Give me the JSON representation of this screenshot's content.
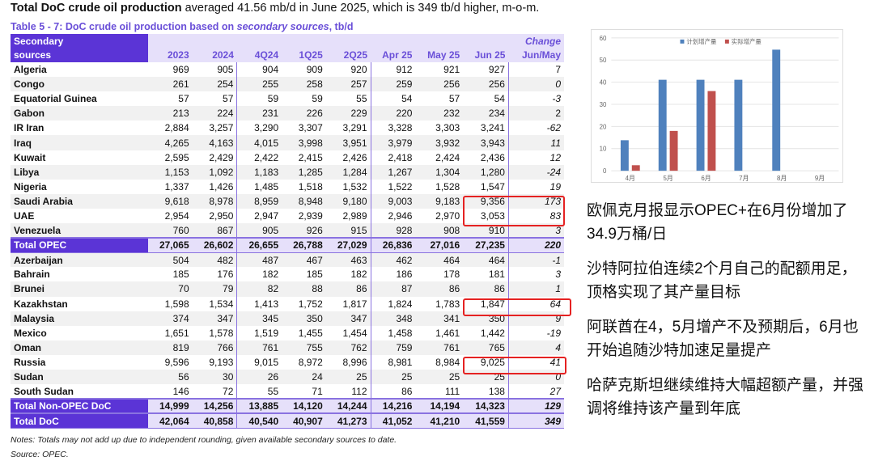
{
  "headline": {
    "bold": "Total DoC crude oil production",
    "rest": " averaged 41.56 mb/d in June 2025, which is 349 tb/d higher, m-o-m."
  },
  "caption": {
    "pre": "Table 5 - 7: DoC crude oil production based on ",
    "ital": "secondary sources",
    "post": ", tb/d"
  },
  "header": {
    "label1": "Secondary",
    "label2": "sources",
    "change1": "Change",
    "cols": [
      "2023",
      "2024",
      "4Q24",
      "1Q25",
      "2Q25",
      "Apr 25",
      "May 25",
      "Jun 25",
      "Jun/May"
    ]
  },
  "rows": [
    [
      "Algeria",
      "969",
      "905",
      "904",
      "909",
      "920",
      "912",
      "921",
      "927",
      "7"
    ],
    [
      "Congo",
      "261",
      "254",
      "255",
      "258",
      "257",
      "259",
      "256",
      "256",
      "0"
    ],
    [
      "Equatorial Guinea",
      "57",
      "57",
      "59",
      "59",
      "55",
      "54",
      "57",
      "54",
      "-3"
    ],
    [
      "Gabon",
      "213",
      "224",
      "231",
      "226",
      "229",
      "220",
      "232",
      "234",
      "2"
    ],
    [
      "IR Iran",
      "2,884",
      "3,257",
      "3,290",
      "3,307",
      "3,291",
      "3,328",
      "3,303",
      "3,241",
      "-62"
    ],
    [
      "Iraq",
      "4,265",
      "4,163",
      "4,015",
      "3,998",
      "3,951",
      "3,979",
      "3,932",
      "3,943",
      "11"
    ],
    [
      "Kuwait",
      "2,595",
      "2,429",
      "2,422",
      "2,415",
      "2,426",
      "2,418",
      "2,424",
      "2,436",
      "12"
    ],
    [
      "Libya",
      "1,153",
      "1,092",
      "1,183",
      "1,285",
      "1,284",
      "1,267",
      "1,304",
      "1,280",
      "-24"
    ],
    [
      "Nigeria",
      "1,337",
      "1,426",
      "1,485",
      "1,518",
      "1,532",
      "1,522",
      "1,528",
      "1,547",
      "19"
    ],
    [
      "Saudi Arabia",
      "9,618",
      "8,978",
      "8,959",
      "8,948",
      "9,180",
      "9,003",
      "9,183",
      "9,356",
      "173"
    ],
    [
      "UAE",
      "2,954",
      "2,950",
      "2,947",
      "2,939",
      "2,989",
      "2,946",
      "2,970",
      "3,053",
      "83"
    ],
    [
      "Venezuela",
      "760",
      "867",
      "905",
      "926",
      "915",
      "928",
      "908",
      "910",
      "3"
    ],
    [
      "Total  OPEC",
      "27,065",
      "26,602",
      "26,655",
      "26,788",
      "27,029",
      "26,836",
      "27,016",
      "27,235",
      "220"
    ],
    [
      "Azerbaijan",
      "504",
      "482",
      "487",
      "467",
      "463",
      "462",
      "464",
      "464",
      "-1"
    ],
    [
      "Bahrain",
      "185",
      "176",
      "182",
      "185",
      "182",
      "186",
      "178",
      "181",
      "3"
    ],
    [
      "Brunei",
      "70",
      "79",
      "82",
      "88",
      "86",
      "87",
      "86",
      "86",
      "1"
    ],
    [
      "Kazakhstan",
      "1,598",
      "1,534",
      "1,413",
      "1,752",
      "1,817",
      "1,824",
      "1,783",
      "1,847",
      "64"
    ],
    [
      "Malaysia",
      "374",
      "347",
      "345",
      "350",
      "347",
      "348",
      "341",
      "350",
      "9"
    ],
    [
      "Mexico",
      "1,651",
      "1,578",
      "1,519",
      "1,455",
      "1,454",
      "1,458",
      "1,461",
      "1,442",
      "-19"
    ],
    [
      "Oman",
      "819",
      "766",
      "761",
      "755",
      "762",
      "759",
      "761",
      "765",
      "4"
    ],
    [
      "Russia",
      "9,596",
      "9,193",
      "9,015",
      "8,972",
      "8,996",
      "8,981",
      "8,984",
      "9,025",
      "41"
    ],
    [
      "Sudan",
      "56",
      "30",
      "26",
      "24",
      "25",
      "25",
      "25",
      "25",
      "0"
    ],
    [
      "South Sudan",
      "146",
      "72",
      "55",
      "71",
      "112",
      "86",
      "111",
      "138",
      "27"
    ],
    [
      "Total Non-OPEC DoC",
      "14,999",
      "14,256",
      "13,885",
      "14,120",
      "14,244",
      "14,216",
      "14,194",
      "14,323",
      "129"
    ],
    [
      "Total DoC",
      "42,064",
      "40,858",
      "40,540",
      "40,907",
      "41,273",
      "41,052",
      "41,210",
      "41,559",
      "349"
    ]
  ],
  "notes": "Notes: Totals may not add up due to independent rounding, given available secondary sources to date.",
  "source": "Source: OPEC.",
  "chart_data": {
    "type": "bar",
    "categories": [
      "4月",
      "5月",
      "6月",
      "7月",
      "8月",
      "9月"
    ],
    "series": [
      {
        "name": "计划增产量",
        "color": "#4f81bd",
        "values": [
          13.8,
          41.1,
          41.1,
          41.1,
          54.7,
          null
        ]
      },
      {
        "name": "实际增产量",
        "color": "#c0504d",
        "values": [
          2.5,
          18,
          36,
          null,
          null,
          null
        ]
      }
    ],
    "ylim": [
      0,
      60
    ],
    "yticks": [
      0,
      10,
      20,
      30,
      40,
      50,
      60
    ],
    "legend": "top-center",
    "grid": true
  },
  "commentary": [
    "欧佩克月报显示OPEC+在6月份增加了34.9万桶/日",
    "沙特阿拉伯连续2个月自己的配额用足，顶格实现了其产量目标",
    "阿联酋在4，5月增产不及预期后，6月也开始追随沙特加速足量提产",
    "哈萨克斯坦继续维持大幅超额产量，并强调将维持该产量到年底"
  ]
}
